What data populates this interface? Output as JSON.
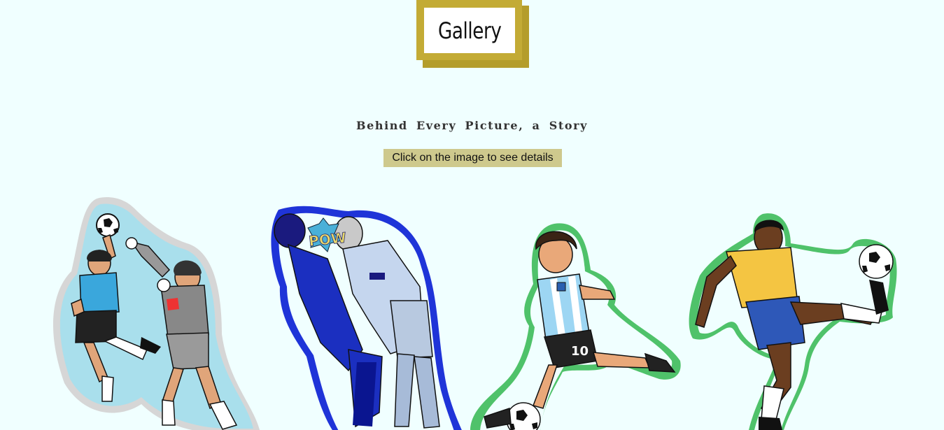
{
  "header": {
    "title": "Gallery"
  },
  "intro": {
    "subtitle": "Behind Every Picture, a Story",
    "hint": "Click on the image to see details"
  },
  "colors": {
    "background": "#f0ffff",
    "title_frame": "#c3ab35",
    "title_shadow": "#b49d2b",
    "hint_bg": "#cec98d"
  },
  "gallery": {
    "images": [
      {
        "icon": "hand-of-god-sticker-icon"
      },
      {
        "icon": "headbutt-sticker-icon",
        "caption": "POW"
      },
      {
        "icon": "argentina-number-10-sticker-icon",
        "shirt_number": "10"
      },
      {
        "icon": "brazil-player-volley-sticker-icon"
      }
    ]
  }
}
